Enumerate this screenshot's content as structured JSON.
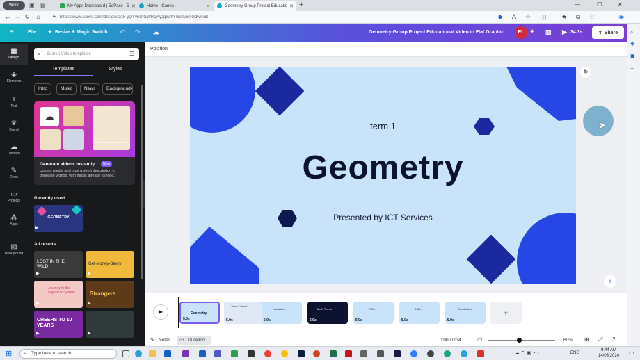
{
  "browser": {
    "profile": "Work",
    "tabs": [
      {
        "title": "My Apps Dashboard | EdPass - E"
      },
      {
        "title": "Home - Canva"
      },
      {
        "title": "Geometry Group Project Educatio"
      }
    ],
    "url": "https://www.canva.com/design/DAF-yQYy5U/GWRG4yzgWjhYGo4v6mGdw/edit"
  },
  "topbar": {
    "file": "File",
    "resize": "Resize & Magic Switch",
    "title": "Geometry Group Project Educational Video in Flat Graphic ...",
    "avatar": "EL",
    "duration": "34.3s",
    "share": "Share"
  },
  "rail": [
    {
      "icon": "design-icon",
      "label": "Design"
    },
    {
      "icon": "elements-icon",
      "label": "Elements"
    },
    {
      "icon": "text-icon",
      "label": "Text"
    },
    {
      "icon": "brand-icon",
      "label": "Brand"
    },
    {
      "icon": "uploads-icon",
      "label": "Uploads"
    },
    {
      "icon": "draw-icon",
      "label": "Draw"
    },
    {
      "icon": "projects-icon",
      "label": "Projects"
    },
    {
      "icon": "apps-icon",
      "label": "Apps"
    },
    {
      "icon": "background-icon",
      "label": "Background"
    }
  ],
  "panel": {
    "search_placeholder": "Search Video templates",
    "tabs": [
      "Templates",
      "Styles"
    ],
    "chips": [
      "Intro",
      "Music",
      "News",
      "Background"
    ],
    "promo": {
      "title": "Generate videos instantly",
      "badge": "New",
      "desc": "Upload media and type a short description to generate videos, with music already synced."
    },
    "recent_title": "Recently used",
    "recent_thumb": "GEOMETRY",
    "all_title": "All results",
    "results": [
      {
        "text": "LOST IN THE WILD"
      },
      {
        "text": "Get Money-Savvy!"
      },
      {
        "text": "Journey to the Digestive System"
      },
      {
        "text": "Strangers"
      },
      {
        "text": "CHEERS TO 10 YEARS"
      },
      {
        "text": ""
      }
    ]
  },
  "editor": {
    "position": "Position",
    "slide": {
      "subtitle": "term 1",
      "title": "Geometry",
      "byline": "Presented by ICT Services"
    }
  },
  "timeline": {
    "clips": [
      {
        "label": "Geometry",
        "dur": "5.0s"
      },
      {
        "label": "Team Project",
        "dur": "5.0s"
      },
      {
        "label": "Activities",
        "dur": "5.0s"
      },
      {
        "label": "Math Terms",
        "dur": "5.0s"
      },
      {
        "label": "2-Dim",
        "dur": "5.0s"
      },
      {
        "label": "3-Dim",
        "dur": "5.0s"
      },
      {
        "label": "Conclusion",
        "dur": "5.0s"
      }
    ],
    "add": "+"
  },
  "footer": {
    "notes": "Notes",
    "duration": "Duration",
    "time": "0:00 / 0:34",
    "zoom": "60%"
  },
  "taskbar": {
    "search": "Type here to search",
    "lang": "ENG",
    "time": "9:44 AM",
    "date": "14/03/2024"
  },
  "colors": {
    "navy": "#1a2a9e",
    "blue": "#2646e6",
    "slide_bg": "#c8e3fa",
    "canva_dark": "#18191b"
  }
}
